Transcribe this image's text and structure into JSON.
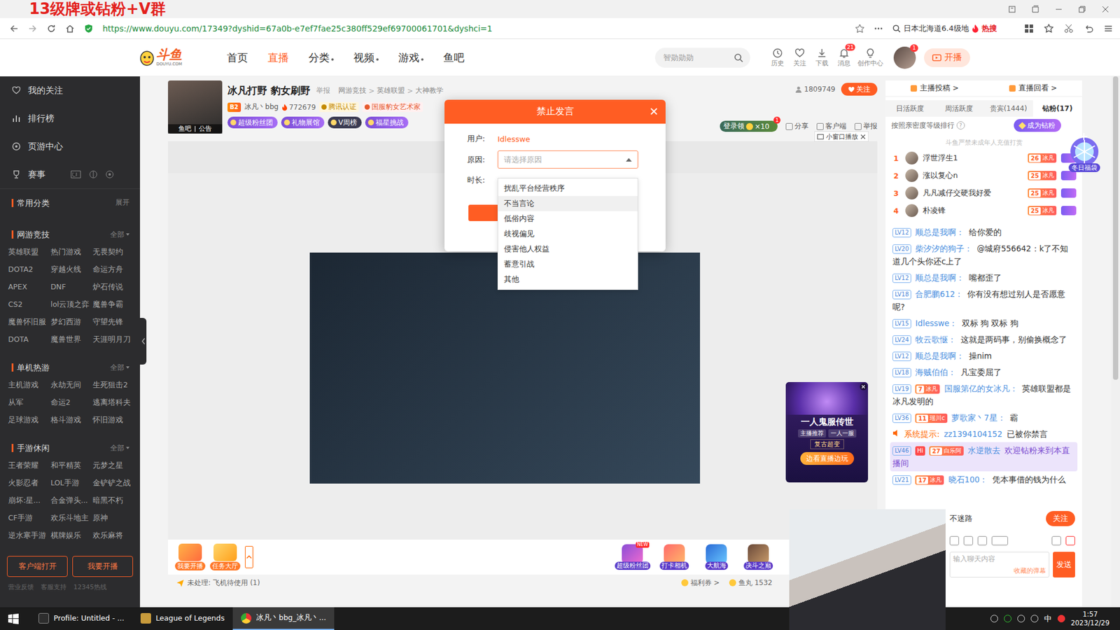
{
  "overlay_banner": "13级牌或钻粉+V群",
  "address_bar": {
    "url": "https://www.douyu.com/17349?dyshid=67a0b-e7ef7fae25c380ff529ef69700061701&dyshci=1",
    "search": "日本北海道6.4级地",
    "hot": "热搜"
  },
  "header": {
    "logo": "斗鱼",
    "logo_sub": "DOUYU.COM",
    "nav": [
      {
        "label": "首页",
        "selected": false,
        "has_menu": false
      },
      {
        "label": "直播",
        "selected": true,
        "has_menu": false
      },
      {
        "label": "分类",
        "selected": false,
        "has_menu": true
      },
      {
        "label": "视频",
        "selected": false,
        "has_menu": true
      },
      {
        "label": "游戏",
        "selected": false,
        "has_menu": true
      },
      {
        "label": "鱼吧",
        "selected": false,
        "has_menu": false
      }
    ],
    "search_placeholder": "智勋勋勋",
    "tools": [
      {
        "label": "历史",
        "badge": ""
      },
      {
        "label": "关注",
        "badge": ""
      },
      {
        "label": "下载",
        "badge": ""
      },
      {
        "label": "消息",
        "badge": "21"
      },
      {
        "label": "创作中心",
        "badge": ""
      }
    ],
    "avatar_badge": "1",
    "live_button": "开播"
  },
  "sidebar": {
    "links": [
      {
        "label": "我的关注"
      },
      {
        "label": "排行榜"
      },
      {
        "label": "页游中心"
      },
      {
        "label": "赛事"
      }
    ],
    "common": {
      "title": "常用分类",
      "action": "展开"
    },
    "sections": [
      {
        "title": "网游竞技",
        "action": "全部",
        "games": [
          "英雄联盟",
          "热门游戏",
          "无畏契约",
          "DOTA2",
          "穿越火线",
          "命运方舟",
          "APEX",
          "DNF",
          "炉石传说",
          "CS2",
          "lol云顶之弈",
          "魔兽争霸",
          "魔兽怀旧服",
          "梦幻西游",
          "守望先锋",
          "DOTA",
          "魔兽世界",
          "天涯明月刀"
        ]
      },
      {
        "title": "单机热游",
        "action": "全部",
        "games": [
          "主机游戏",
          "永劫无间",
          "生死狙击2",
          "从军",
          "命运2",
          "逃离塔科夫",
          "足球游戏",
          "格斗游戏",
          "怀旧游戏"
        ]
      },
      {
        "title": "手游休闲",
        "action": "全部",
        "games": [
          "王者荣耀",
          "和平精英",
          "元梦之星",
          "火影忍者",
          "LOL手游",
          "金铲铲之战",
          "崩坏:星...",
          "合金弹头...",
          "暗黑不朽",
          "CF手游",
          "欢乐斗地主",
          "原神",
          "逆水寒手游",
          "棋牌娱乐",
          "欢乐麻将"
        ]
      }
    ],
    "buttons": [
      "客户端打开",
      "我要开播"
    ],
    "footer": [
      "营业反馈",
      "客服支持",
      "12345热线"
    ]
  },
  "room": {
    "avatar_caption": [
      "鱼吧",
      "公告"
    ],
    "name": "冰凡打野 豹女刷野",
    "report": "举报",
    "crumbs": [
      "网游竞技",
      "英雄联盟",
      "大神教学"
    ],
    "crumb_sep": ">",
    "level": "B2",
    "owner": "冰凡丶bbg",
    "hot": "772679",
    "badges": [
      "腾讯认证",
      "国服豹女艺术家"
    ],
    "row2": [
      "超级粉丝团",
      "礼物展馆",
      "V周榜",
      "福星挑战"
    ],
    "followers": "1809749",
    "follow": "关注",
    "login_reward": {
      "label": "登录领",
      "count": "×10",
      "badge": "1"
    },
    "actions": [
      "分享",
      "客户端",
      "举报"
    ],
    "mini_player": "小窗口播放"
  },
  "ad": {
    "title": "一人鬼服传世",
    "tags": [
      "主播推荐",
      "一人一服"
    ],
    "subtitle": "复古超变",
    "button": "边看直播边玩"
  },
  "toolbar": {
    "left": [
      "我要开播",
      "任务大厅"
    ],
    "gifts": [
      {
        "label": "超级粉丝团",
        "badge": "NEW"
      },
      {
        "label": "打卡相机",
        "badge": ""
      },
      {
        "label": "大航海",
        "badge": ""
      },
      {
        "label": "决斗之巅",
        "badge": ""
      }
    ],
    "pending": "未处理: 飞机待使用 (1)",
    "wallet": [
      "福利券 >",
      "鱼丸 1532"
    ]
  },
  "chat": {
    "links": [
      "主播投稿 >",
      "直播回看 >"
    ],
    "tabs": [
      {
        "label": "日活跃度",
        "selected": false
      },
      {
        "label": "周活跃度",
        "selected": false
      },
      {
        "label": "贵宾(1444)",
        "selected": false
      },
      {
        "label": "钻粉(17)",
        "selected": true
      }
    ],
    "rank_title": "按照亲密度等级排行",
    "rank_help": "?",
    "become": "成为钻粉",
    "notice": "斗鱼严禁未成年人充值打赏",
    "ranks": [
      {
        "rank": "1",
        "name": "浮世浮生1",
        "level": "26",
        "fan": "冰凡"
      },
      {
        "rank": "2",
        "name": "涨以复心n",
        "level": "25",
        "fan": "冰凡"
      },
      {
        "rank": "3",
        "name": "凡凡减仔交硬我好爱",
        "level": "25",
        "fan": "冰凡"
      },
      {
        "rank": "4",
        "name": "朴凌锋",
        "level": "25",
        "fan": "冰凡"
      }
    ],
    "messages": [
      {
        "kind": "message",
        "level": "LV12",
        "name": "顺总是我啊：",
        "text": "给你爱的"
      },
      {
        "kind": "message",
        "level": "LV20",
        "name": "柴汐汐的狗子：",
        "text": "@城府556642：k了不知道几个头你还c上了"
      },
      {
        "kind": "message",
        "level": "LV12",
        "name": "顺总是我啊：",
        "text": "嘴都歪了"
      },
      {
        "kind": "message",
        "level": "LV18",
        "name": "合肥鹏612：",
        "text": "你有没有想过别人是否愿意呢?"
      },
      {
        "kind": "message",
        "level": "LV15",
        "name": "Idlesswe：",
        "text": "双标 狗 双标 狗"
      },
      {
        "kind": "message",
        "level": "LV24",
        "name": "牧云歌惬：",
        "text": "这就是两码事，别偷换概念了"
      },
      {
        "kind": "message",
        "level": "LV12",
        "name": "顺总是我啊：",
        "text": "操nim"
      },
      {
        "kind": "message",
        "level": "LV18",
        "name": "海贼伯伯：",
        "text": "凡宝委屈了"
      },
      {
        "kind": "message",
        "level": "LV19",
        "fan": {
          "level": "7",
          "name": "冰凡"
        },
        "name": "国服第亿的女冰凡：",
        "text": "英雄联盟都是冰凡发明的"
      },
      {
        "kind": "message",
        "level": "LV36",
        "fan": {
          "level": "11",
          "name": "瑶川c"
        },
        "name": "萝歌家丶7星：",
        "text": "霸"
      },
      {
        "kind": "system",
        "label": "系统提示:",
        "name": "zz1394104152",
        "text": "已被你禁言"
      },
      {
        "kind": "welcome",
        "level": "LV46",
        "hi": "Hi",
        "fan": {
          "level": "27",
          "name": "白乐阿"
        },
        "name": "水逆散去",
        "text": "欢迎钻粉来到本直播间"
      },
      {
        "kind": "message",
        "level": "LV21",
        "fan": {
          "level": "17",
          "name": "冰凡"
        },
        "name": "晓石100：",
        "text": "凭本事借的钱为什么"
      }
    ],
    "follow_banner": {
      "text": "不迷路",
      "button": "关注"
    },
    "input_placeholder": "输入聊天内容",
    "saved": "收藏的弹幕",
    "send": "发送"
  },
  "winter_bag": "冬日福袋",
  "modal": {
    "title": "禁止发言",
    "user_label": "用户:",
    "user": "Idlesswe",
    "reason_label": "原因:",
    "reason_placeholder": "请选择原因",
    "duration_label": "时长:",
    "expanded": true,
    "options": [
      {
        "label": "扰乱平台经营秩序",
        "hovered": false
      },
      {
        "label": "不当言论",
        "hovered": true
      },
      {
        "label": "低俗内容",
        "hovered": false
      },
      {
        "label": "歧视偏见",
        "hovered": false
      },
      {
        "label": "侵害他人权益",
        "hovered": false
      },
      {
        "label": "蓄意引战",
        "hovered": false
      },
      {
        "label": "其他",
        "hovered": false
      }
    ]
  },
  "taskbar": {
    "items": [
      {
        "label": "Profile: Untitled - ...",
        "selected": false
      },
      {
        "label": "League of Legends",
        "selected": false
      },
      {
        "label": "冰凡丶bbg_冰凡丶...",
        "selected": true
      }
    ],
    "ime": "中",
    "time": "1:57",
    "date": "2023/12/29"
  }
}
